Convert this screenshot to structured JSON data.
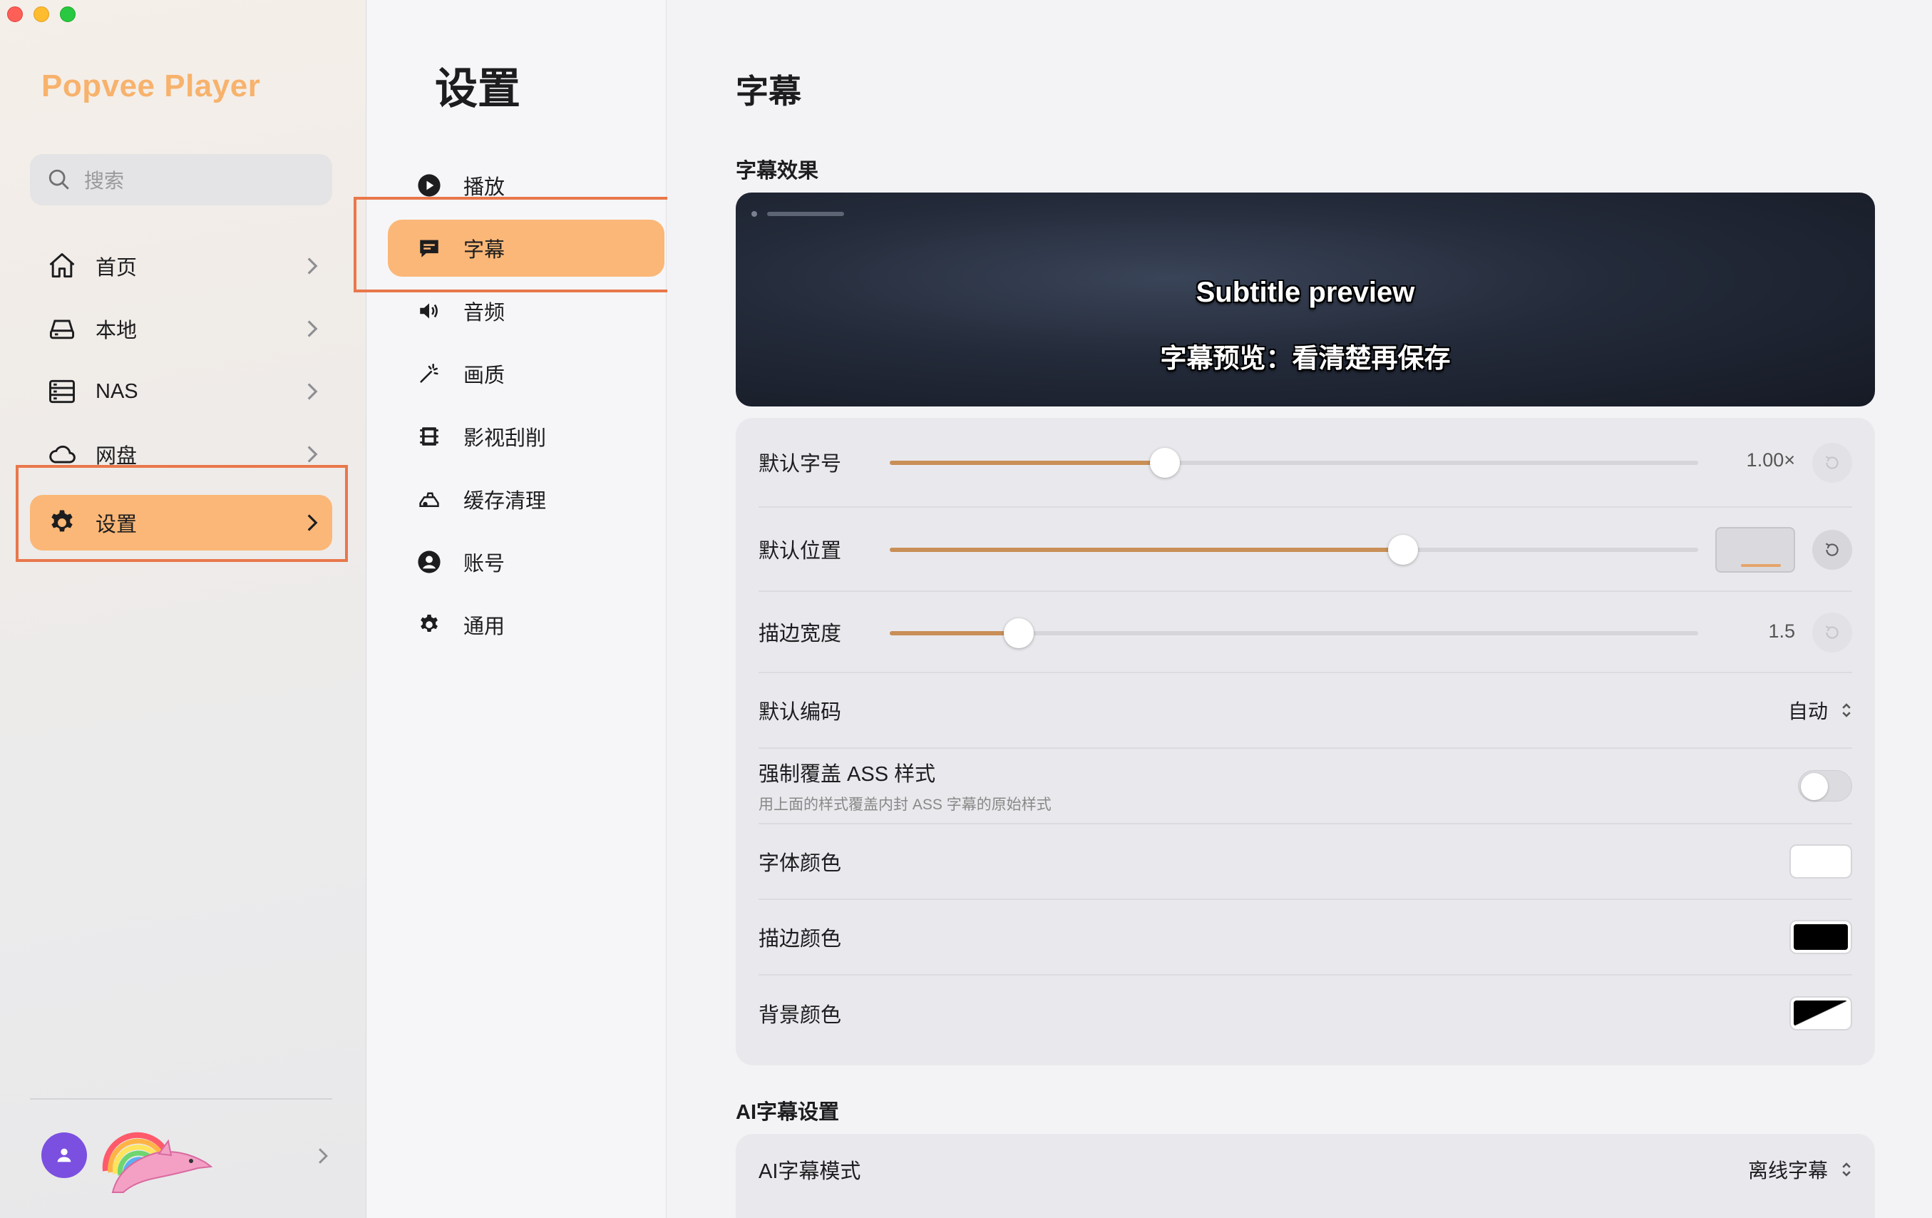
{
  "window": {
    "controls": [
      "close",
      "minimize",
      "zoom"
    ]
  },
  "sidebar": {
    "brand": "Popvee Player",
    "search_placeholder": "搜索",
    "items": [
      {
        "label": "首页",
        "icon": "home-icon"
      },
      {
        "label": "本地",
        "icon": "drive-icon"
      },
      {
        "label": "NAS",
        "icon": "server-icon"
      },
      {
        "label": "网盘",
        "icon": "cloud-icon"
      },
      {
        "label": "设置",
        "icon": "gear-icon",
        "active": true
      }
    ]
  },
  "settings_nav": {
    "title": "设置",
    "items": [
      {
        "label": "播放",
        "icon": "play-icon"
      },
      {
        "label": "字幕",
        "icon": "subtitle-icon",
        "active": true
      },
      {
        "label": "音频",
        "icon": "speaker-icon"
      },
      {
        "label": "画质",
        "icon": "magic-wand-icon"
      },
      {
        "label": "影视刮削",
        "icon": "film-icon"
      },
      {
        "label": "缓存清理",
        "icon": "cleanup-icon"
      },
      {
        "label": "账号",
        "icon": "account-icon"
      },
      {
        "label": "通用",
        "icon": "gear-icon"
      }
    ]
  },
  "main": {
    "title": "字幕",
    "effects_section": "字幕效果",
    "preview": {
      "line1": "Subtitle preview",
      "line2": "字幕预览：看清楚再保存"
    },
    "rows": {
      "font_size": {
        "label": "默认字号",
        "value": "1.00×",
        "level": 0.34
      },
      "position": {
        "label": "默认位置",
        "level": 0.635
      },
      "stroke_width": {
        "label": "描边宽度",
        "value": "1.5",
        "level": 0.16
      },
      "encoding": {
        "label": "默认编码",
        "value": "自动"
      },
      "force_ass": {
        "label": "强制覆盖 ASS 样式",
        "sublabel": "用上面的样式覆盖内封 ASS 字幕的原始样式",
        "enabled": false
      },
      "font_color": {
        "label": "字体颜色",
        "color": "#ffffff"
      },
      "stroke_color": {
        "label": "描边颜色",
        "color": "#000000"
      },
      "bg_color": {
        "label": "背景颜色"
      }
    },
    "ai_section": "AI字幕设置",
    "ai_mode": {
      "label": "AI字幕模式",
      "value": "离线字幕"
    }
  },
  "colors": {
    "accent": "#fbb777",
    "slider": "#c98f57",
    "highlight_box": "#e9774b"
  }
}
